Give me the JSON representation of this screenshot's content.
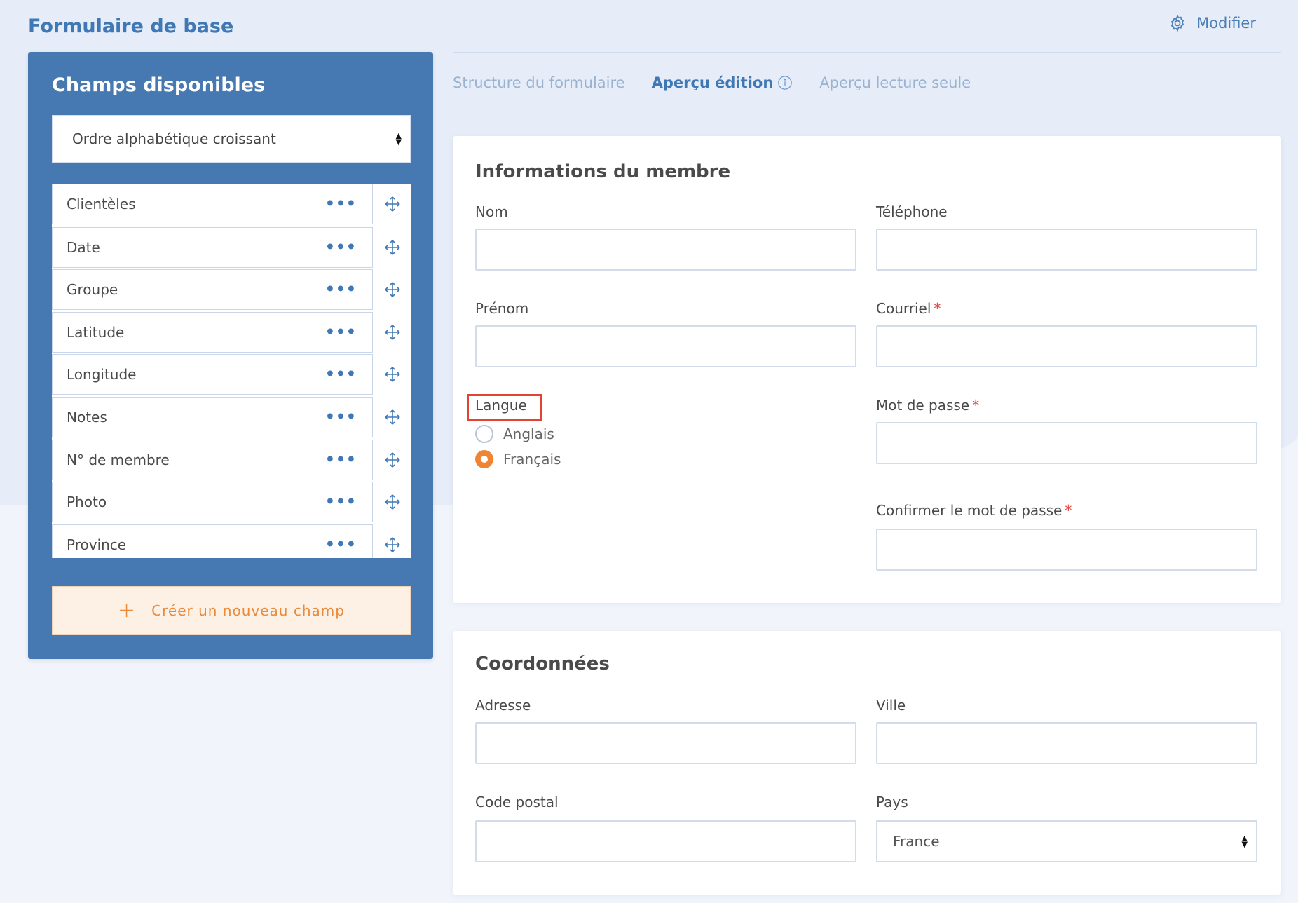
{
  "header": {
    "title": "Formulaire de base",
    "modify_label": "Modifier",
    "modify_icon": "gear-icon"
  },
  "left_panel": {
    "title": "Champs disponibles",
    "sort_select": "Ordre alphabétique croissant",
    "fields": [
      {
        "label": "Clientèles"
      },
      {
        "label": "Date"
      },
      {
        "label": "Groupe"
      },
      {
        "label": "Latitude"
      },
      {
        "label": "Longitude"
      },
      {
        "label": "Notes"
      },
      {
        "label": "N° de membre"
      },
      {
        "label": "Photo"
      },
      {
        "label": "Province"
      }
    ],
    "create_button": "Créer un nouveau champ",
    "more_glyph": "•••"
  },
  "tabs": [
    {
      "label": "Structure du formulaire",
      "active": false
    },
    {
      "label": "Aperçu édition",
      "active": true
    },
    {
      "label": "Aperçu lecture seule",
      "active": false
    }
  ],
  "member_section": {
    "title": "Informations du membre",
    "nom_label": "Nom",
    "telephone_label": "Téléphone",
    "prenom_label": "Prénom",
    "courriel_label": "Courriel",
    "langue_label": "Langue",
    "langue_options": [
      {
        "label": "Anglais",
        "checked": false
      },
      {
        "label": "Français",
        "checked": true
      }
    ],
    "password_label": "Mot de passe",
    "confirm_password_label": "Confirmer le mot de passe",
    "required_mark": "*"
  },
  "coord_section": {
    "title": "Coordonnées",
    "adresse_label": "Adresse",
    "ville_label": "Ville",
    "code_postal_label": "Code postal",
    "pays_label": "Pays",
    "pays_value": "France"
  },
  "colors": {
    "accent_blue": "#4679b1",
    "accent_orange": "#ef8432",
    "required_red": "#e0413a",
    "highlight_red": "#e24433"
  }
}
